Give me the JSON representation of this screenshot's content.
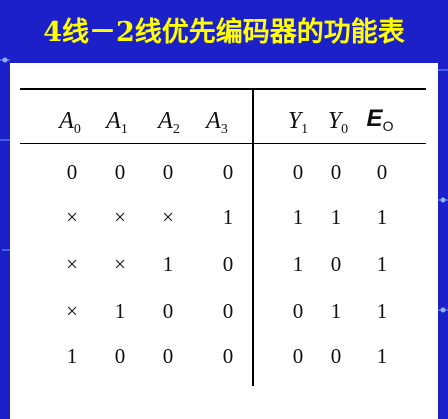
{
  "title": "4线－2线优先编码器的功能表",
  "table": {
    "inputs": [
      {
        "letter": "A",
        "sub": "0"
      },
      {
        "letter": "A",
        "sub": "1"
      },
      {
        "letter": "A",
        "sub": "2"
      },
      {
        "letter": "A",
        "sub": "3"
      }
    ],
    "outputs": [
      {
        "letter": "Y",
        "sub": "1"
      },
      {
        "letter": "Y",
        "sub": "0"
      },
      {
        "letter": "E",
        "sub": "O"
      }
    ],
    "rows": [
      [
        "0",
        "0",
        "0",
        "0",
        "0",
        "0",
        "0"
      ],
      [
        "×",
        "×",
        "×",
        "1",
        "1",
        "1",
        "1"
      ],
      [
        "×",
        "×",
        "1",
        "0",
        "1",
        "0",
        "1"
      ],
      [
        "×",
        "1",
        "0",
        "0",
        "0",
        "1",
        "1"
      ],
      [
        "1",
        "0",
        "0",
        "0",
        "0",
        "0",
        "1"
      ]
    ]
  },
  "colors": {
    "background": "#1c20c8",
    "title": "#ffff00",
    "panel": "#ffffff"
  }
}
